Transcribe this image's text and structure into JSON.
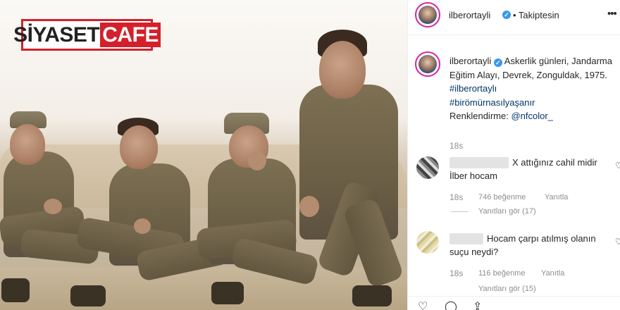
{
  "watermark": {
    "part1": "SİYASET",
    "part2": "CAFE"
  },
  "header": {
    "username": "ilberortayli",
    "follow_status": "• Takiptesin",
    "more_icon": "more-horizontal-icon"
  },
  "caption": {
    "username": "ilberortayli",
    "text": "Askerlik günleri, Jandarma Eğitim Alayı, Devrek, Zonguldak, 1975.",
    "hashtags": [
      "#ilberortaylı",
      "#birömürnasılyaşanır"
    ],
    "credit_label": "Renklendirme:",
    "credit_user": "@nfcolor_",
    "time": "18s"
  },
  "comments": [
    {
      "text_line1": "X attığınız cahil midir",
      "text_line2": "İlber hocam",
      "time": "18s",
      "likes": "746 beğenme",
      "reply": "Yanıtla",
      "view_replies": "Yanıtları gör (17)"
    },
    {
      "text_line1": "Hocam çarpı atılmış olanın",
      "text_line2": "suçu neydi?",
      "time": "18s",
      "likes": "116 beğenme",
      "reply": "Yanıtla",
      "view_replies": "Yanıtları gör (15)"
    }
  ],
  "colors": {
    "watermark_red": "#d3202a",
    "verified_blue": "#3897f0",
    "hashtag": "#003569",
    "meta_gray": "#8e8e8e"
  }
}
